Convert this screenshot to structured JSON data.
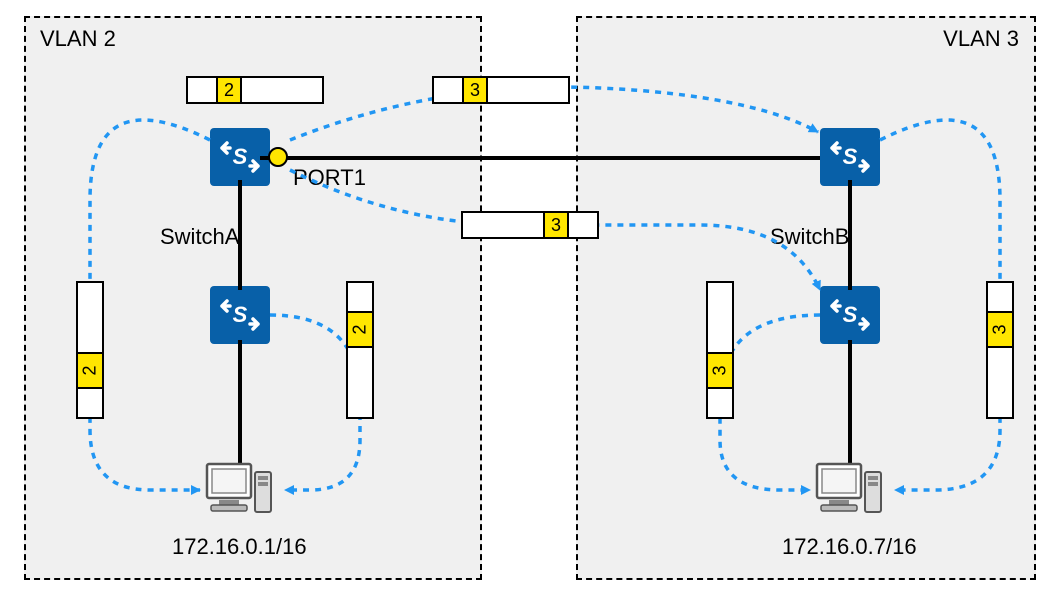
{
  "vlan_left": {
    "title": "VLAN 2",
    "host_ip": "172.16.0.1/16"
  },
  "vlan_right": {
    "title": "VLAN 3",
    "host_ip": "172.16.0.7/16"
  },
  "switch_a": {
    "label": "SwitchA",
    "port1_label": "PORT1"
  },
  "switch_b": {
    "label": "SwitchB"
  },
  "frames": {
    "top_left_tag": "2",
    "top_right_tag": "3",
    "mid_right_tag": "3",
    "left_v1_tag": "2",
    "left_v2_tag": "2",
    "right_v1_tag": "3",
    "right_v2_tag": "3"
  }
}
